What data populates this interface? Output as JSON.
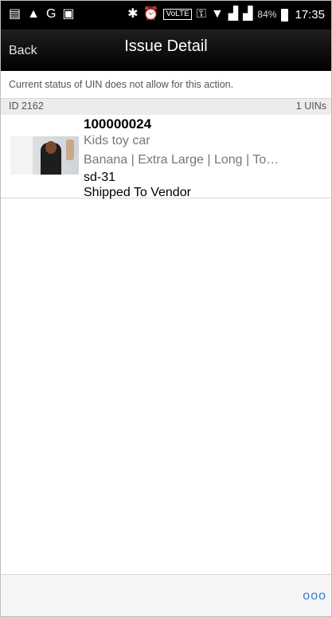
{
  "status_bar": {
    "icons_left": [
      "message-icon",
      "navigation-icon",
      "google-icon",
      "chat-icon"
    ],
    "icons_right": [
      "bluetooth-icon",
      "alarm-icon",
      "volte-icon",
      "key-icon",
      "wifi-icon",
      "signal-icon",
      "signal-icon"
    ],
    "battery": "84%",
    "time": "17:35"
  },
  "header": {
    "back_label": "Back",
    "title": "Issue Detail"
  },
  "notice": "Current status of UIN does not allow for this action.",
  "id_bar": {
    "id": "ID 2162",
    "count": "1 UINs"
  },
  "item": {
    "sku": "100000024",
    "name": "Kids toy car",
    "attributes": "Banana | Extra Large | Long | To…",
    "code": "sd-31",
    "status": "Shipped To Vendor"
  },
  "footer": {
    "more_label": "ooo"
  }
}
